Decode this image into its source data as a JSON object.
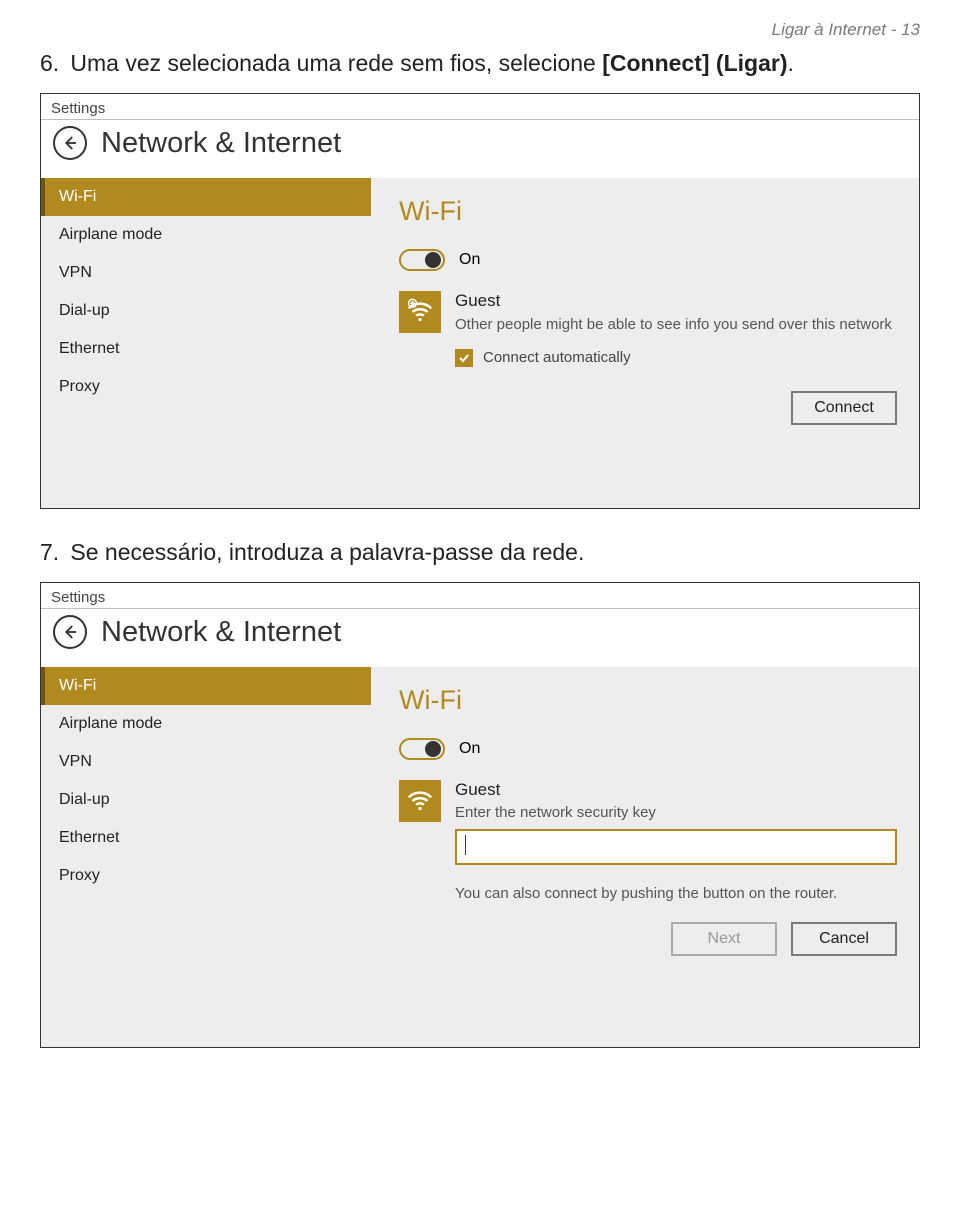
{
  "header": "Ligar à Internet - 13",
  "step6": {
    "num": "6.",
    "text_a": "Uma vez selecionada uma rede sem fios, selecione ",
    "bold": "[Connect] (Ligar)",
    "text_b": "."
  },
  "step7": {
    "num": "7.",
    "text": "Se necessário, introduza a palavra-passe da rede."
  },
  "shot1": {
    "settings": "Settings",
    "title": "Network & Internet",
    "sidebar": [
      "Wi-Fi",
      "Airplane mode",
      "VPN",
      "Dial-up",
      "Ethernet",
      "Proxy"
    ],
    "heading": "Wi-Fi",
    "toggle": "On",
    "net_name": "Guest",
    "net_desc": "Other people might be able to see info you send over this network",
    "auto": "Connect automatically",
    "connect": "Connect"
  },
  "shot2": {
    "settings": "Settings",
    "title": "Network & Internet",
    "sidebar": [
      "Wi-Fi",
      "Airplane mode",
      "VPN",
      "Dial-up",
      "Ethernet",
      "Proxy"
    ],
    "heading": "Wi-Fi",
    "toggle": "On",
    "net_name": "Guest",
    "sec_label": "Enter the network security key",
    "router": "You can also connect by pushing the button on the router.",
    "next": "Next",
    "cancel": "Cancel"
  }
}
